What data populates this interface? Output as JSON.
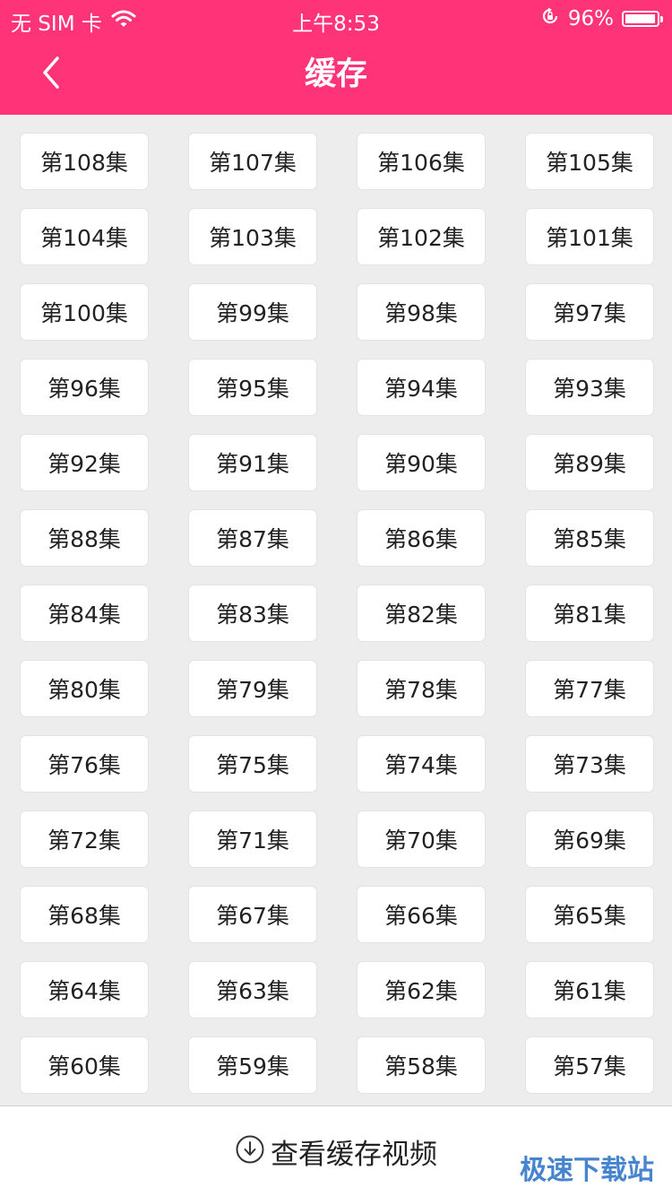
{
  "status_bar": {
    "carrier": "无 SIM 卡",
    "time": "上午8:53",
    "battery": "96%",
    "battery_level": 0.96,
    "icons": [
      "wifi-icon",
      "orientation-lock-icon",
      "battery-icon"
    ]
  },
  "header": {
    "title": "缓存",
    "back_icon": "chevron-left-icon",
    "background_color": "#ff3378"
  },
  "episodes": [
    "第108集",
    "第107集",
    "第106集",
    "第105集",
    "第104集",
    "第103集",
    "第102集",
    "第101集",
    "第100集",
    "第99集",
    "第98集",
    "第97集",
    "第96集",
    "第95集",
    "第94集",
    "第93集",
    "第92集",
    "第91集",
    "第90集",
    "第89集",
    "第88集",
    "第87集",
    "第86集",
    "第85集",
    "第84集",
    "第83集",
    "第82集",
    "第81集",
    "第80集",
    "第79集",
    "第78集",
    "第77集",
    "第76集",
    "第75集",
    "第74集",
    "第73集",
    "第72集",
    "第71集",
    "第70集",
    "第69集",
    "第68集",
    "第67集",
    "第66集",
    "第65集",
    "第64集",
    "第63集",
    "第62集",
    "第61集",
    "第60集",
    "第59集",
    "第58集",
    "第57集"
  ],
  "bottom_bar": {
    "label": "查看缓存视频",
    "icon": "download-circle-icon"
  },
  "watermark": "极速下载站"
}
